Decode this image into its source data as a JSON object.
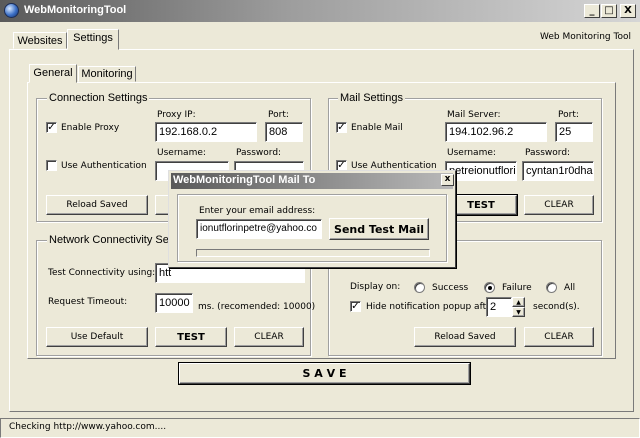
{
  "window": {
    "title": "WebMonitoringTool",
    "minimize_symbol": "_",
    "maximize_symbol": "□",
    "close_symbol": "X"
  },
  "main_tabs": [
    "Websites",
    "Settings"
  ],
  "brand_label": "Web Monitoring Tool",
  "sub_tabs": [
    "General",
    "Monitoring"
  ],
  "connection": {
    "legend": "Connection Settings",
    "enable_proxy_label": "Enable Proxy",
    "enable_proxy_checked": true,
    "proxy_ip_label": "Proxy IP:",
    "proxy_ip_value": "192.168.0.2",
    "port_label": "Port:",
    "port_value": "808",
    "use_auth_label": "Use Authentication",
    "use_auth_checked": false,
    "username_label": "Username:",
    "password_label": "Password:",
    "reload_label": "Reload Saved"
  },
  "mail": {
    "legend": "Mail Settings",
    "enable_mail_label": "Enable Mail",
    "enable_mail_checked": true,
    "server_label": "Mail Server:",
    "server_value": "194.102.96.2",
    "port_label": "Port:",
    "port_value": "25",
    "use_auth_label": "Use Authentication",
    "use_auth_checked": true,
    "username_label": "Username:",
    "username_value": "petreionutflori",
    "password_label": "Password:",
    "password_value": "cyntan1r0dha",
    "test_label": "TEST",
    "clear_label": "CLEAR"
  },
  "network": {
    "legend": "Network Connectivity Set",
    "test_using_label": "Test Connectivity using:",
    "test_using_value": "htt",
    "timeout_label": "Request Timeout:",
    "timeout_value": "10000",
    "timeout_suffix": "ms. (recomended: 10000)",
    "use_default_label": "Use Default",
    "test_label": "TEST",
    "clear_label": "CLEAR"
  },
  "notification": {
    "display_on_label": "Display on:",
    "options": [
      "Success",
      "Failure",
      "All"
    ],
    "selected": "Failure",
    "hide_popup_label": "Hide notification popup after:",
    "hide_popup_checked": true,
    "seconds_value": "2",
    "seconds_label": "second(s).",
    "reload_label": "Reload Saved",
    "clear_label": "CLEAR"
  },
  "save_label": "S A V E",
  "status_text": "Checking http://www.yahoo.com....",
  "dialog": {
    "title": "WebMonitoringTool Mail To",
    "close_symbol": "x",
    "prompt": "Enter your email address:",
    "email_value": "ionutflorinpetre@yahoo.co",
    "send_label": "Send Test Mail"
  }
}
